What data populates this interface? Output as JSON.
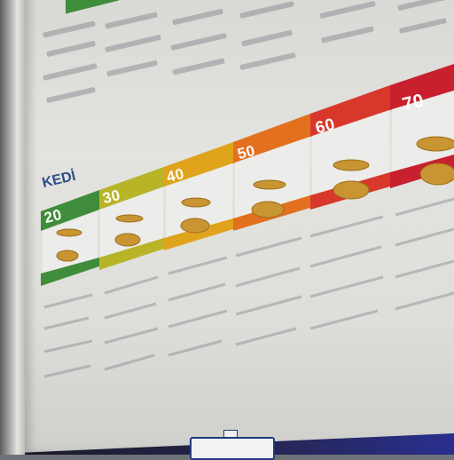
{
  "poster": {
    "category_title": "KEDİ",
    "weight_bands": [
      {
        "label": "20",
        "color": "#3f8d3a"
      },
      {
        "label": "30",
        "color": "#b8b428"
      },
      {
        "label": "40",
        "color": "#e0a31c"
      },
      {
        "label": "50",
        "color": "#e2701f"
      },
      {
        "label": "60",
        "color": "#d8372b"
      },
      {
        "label": "70",
        "color": "#c8202d"
      }
    ]
  }
}
